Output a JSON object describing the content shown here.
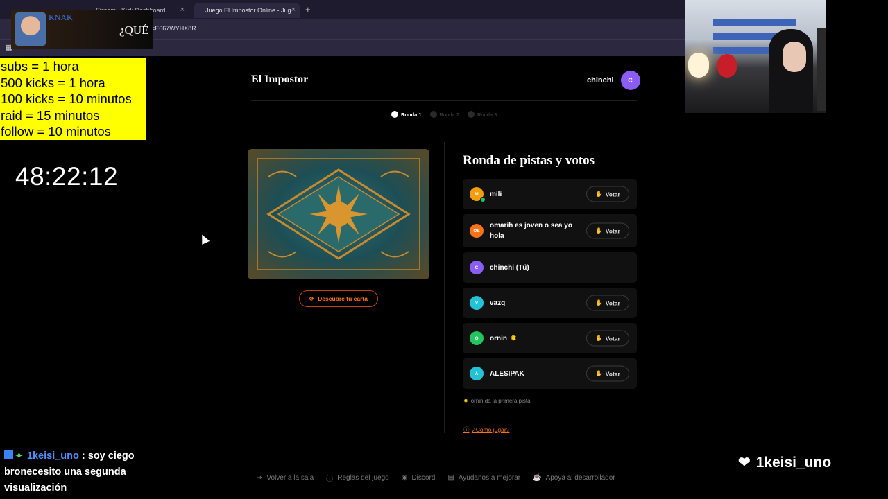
{
  "browser": {
    "tabs": [
      {
        "label": "Stream - Kick Dashboard"
      },
      {
        "label": "Juego El Impostor Online - Jug"
      }
    ],
    "url_fragment": "=E667WYHX8R",
    "close_glyph": "×",
    "add_glyph": "+"
  },
  "overlay": {
    "knak_name": "KNAK",
    "knak_text": "¿QUÉ",
    "subs_rules": [
      "subs = 1 hora",
      "500 kicks = 1 hora",
      "100 kicks = 10 minutos",
      "raid = 15 minutos",
      "follow = 10 minutos"
    ],
    "timer": "48:22:12",
    "chat": {
      "username": "1keisi_uno",
      "message": "soy ciego bronecesito una segunda visualización"
    },
    "follow_name": "1keisi_uno"
  },
  "game": {
    "brand": "El Impostor",
    "user_name": "chinchi",
    "user_initial": "C",
    "rounds": [
      {
        "label": "Ronda 1",
        "active": true
      },
      {
        "label": "Ronda 2",
        "active": false
      },
      {
        "label": "Ronda 3",
        "active": false
      }
    ],
    "discover_label": "Descubre tu carta",
    "panel_title": "Ronda de pistas y votos",
    "vote_label": "Votar",
    "players": [
      {
        "initials": "M",
        "name": "mili",
        "color": "#f59e0b",
        "vote": true,
        "online": true,
        "sun": false
      },
      {
        "initials": "OE",
        "name": "omarih es joven o sea yo hola",
        "color": "#f97316",
        "vote": true,
        "online": false,
        "sun": false
      },
      {
        "initials": "C",
        "name": "chinchi (Tú)",
        "color": "#8b5cf6",
        "vote": false,
        "online": false,
        "sun": false
      },
      {
        "initials": "V",
        "name": "vazq",
        "color": "#22c3d6",
        "vote": true,
        "online": false,
        "sun": false
      },
      {
        "initials": "O",
        "name": "ornin",
        "color": "#22c55e",
        "vote": true,
        "online": false,
        "sun": true
      },
      {
        "initials": "A",
        "name": "ALESIPAK",
        "color": "#22c3d6",
        "vote": true,
        "online": false,
        "sun": false
      }
    ],
    "hint": "ornin da la primera pista",
    "howto": "¿Cómo jugar?",
    "footer": [
      {
        "label": "Volver a la sala",
        "icon": "exit-icon"
      },
      {
        "label": "Reglas del juego",
        "icon": "info-icon"
      },
      {
        "label": "Discord",
        "icon": "discord-icon"
      },
      {
        "label": "Ayudanos a mejorar",
        "icon": "feedback-icon"
      },
      {
        "label": "Apoya al desarrollador",
        "icon": "coffee-icon"
      }
    ]
  },
  "colors": {
    "accent": "#f97316",
    "user_avatar": "#8b5cf6",
    "subs_bg": "#ffff00",
    "chat_username": "#4f8ef7"
  }
}
